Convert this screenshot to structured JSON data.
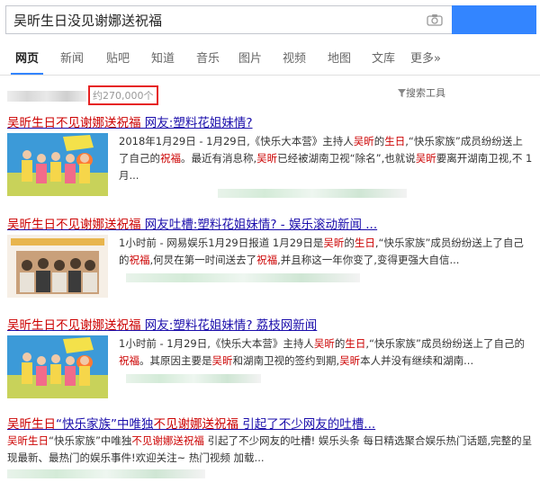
{
  "search": {
    "query": "吴昕生日没见谢娜送祝福",
    "button_label": ""
  },
  "tabs": [
    {
      "label": "网页",
      "active": true
    },
    {
      "label": "新闻"
    },
    {
      "label": "贴吧"
    },
    {
      "label": "知道"
    },
    {
      "label": "音乐"
    },
    {
      "label": "图片"
    },
    {
      "label": "视频"
    },
    {
      "label": "地图"
    },
    {
      "label": "文库"
    },
    {
      "label": "更多»"
    }
  ],
  "stats": {
    "count_text": "约270,000个",
    "tools_label": "搜索工具"
  },
  "results": [
    {
      "title": [
        "吴昕生日不见谢娜送祝福",
        " 网友:塑料花姐妹情?"
      ],
      "snippet": [
        "2018年1月29日 - 1月29日,《快乐大本营》主持人",
        "吴昕",
        "的",
        "生日",
        ",“快乐家族”成员纷纷送上了自己的",
        "祝福",
        "。最近有消息称,",
        "吴昕",
        "已经被湖南卫视“除名”,也就说",
        "吴昕",
        "要离开湖南卫视,不 1月..."
      ]
    },
    {
      "title": [
        "吴昕生日不见谢娜送祝福",
        " 网友吐槽:塑料花姐妹情? - 娱乐滚动新闻 ..."
      ],
      "snippet": [
        "1小时前 - 网易娱乐1月29日报道 1月29日是",
        "吴昕",
        "的",
        "生日",
        ",“快乐家族”成员纷纷送上了自己的",
        "祝福",
        ",何炅在第一时间送去了",
        "祝福",
        ",并且称这一年你变了,变得更强大自信..."
      ]
    },
    {
      "title": [
        "吴昕生日不见谢娜送祝福",
        " 网友:塑料花姐妹情? 荔枝网新闻"
      ],
      "snippet": [
        "1小时前 - 1月29日,《快乐大本营》主持人",
        "吴昕",
        "的",
        "生日",
        ",“快乐家族”成员纷纷送上了自己的",
        "祝福",
        "。其原因主要是",
        "吴昕",
        "和湖南卫视的签约到期,",
        "吴昕",
        "本人并没有继续和湖南..."
      ]
    },
    {
      "title": [
        "吴昕生日",
        "“快乐家族”中唯独",
        "不见谢娜送祝福",
        " 引起了不少网友的吐槽..."
      ],
      "snippet": [
        "吴昕生日",
        "“快乐家族”中唯独",
        "不见谢娜送祝福",
        " 引起了不少网友的吐槽! 娱乐头条 每日精选聚合娱乐热门话题,完整的呈现最新、最热门的娱乐事件!欢迎关注~ 热门视频 加载..."
      ]
    }
  ]
}
